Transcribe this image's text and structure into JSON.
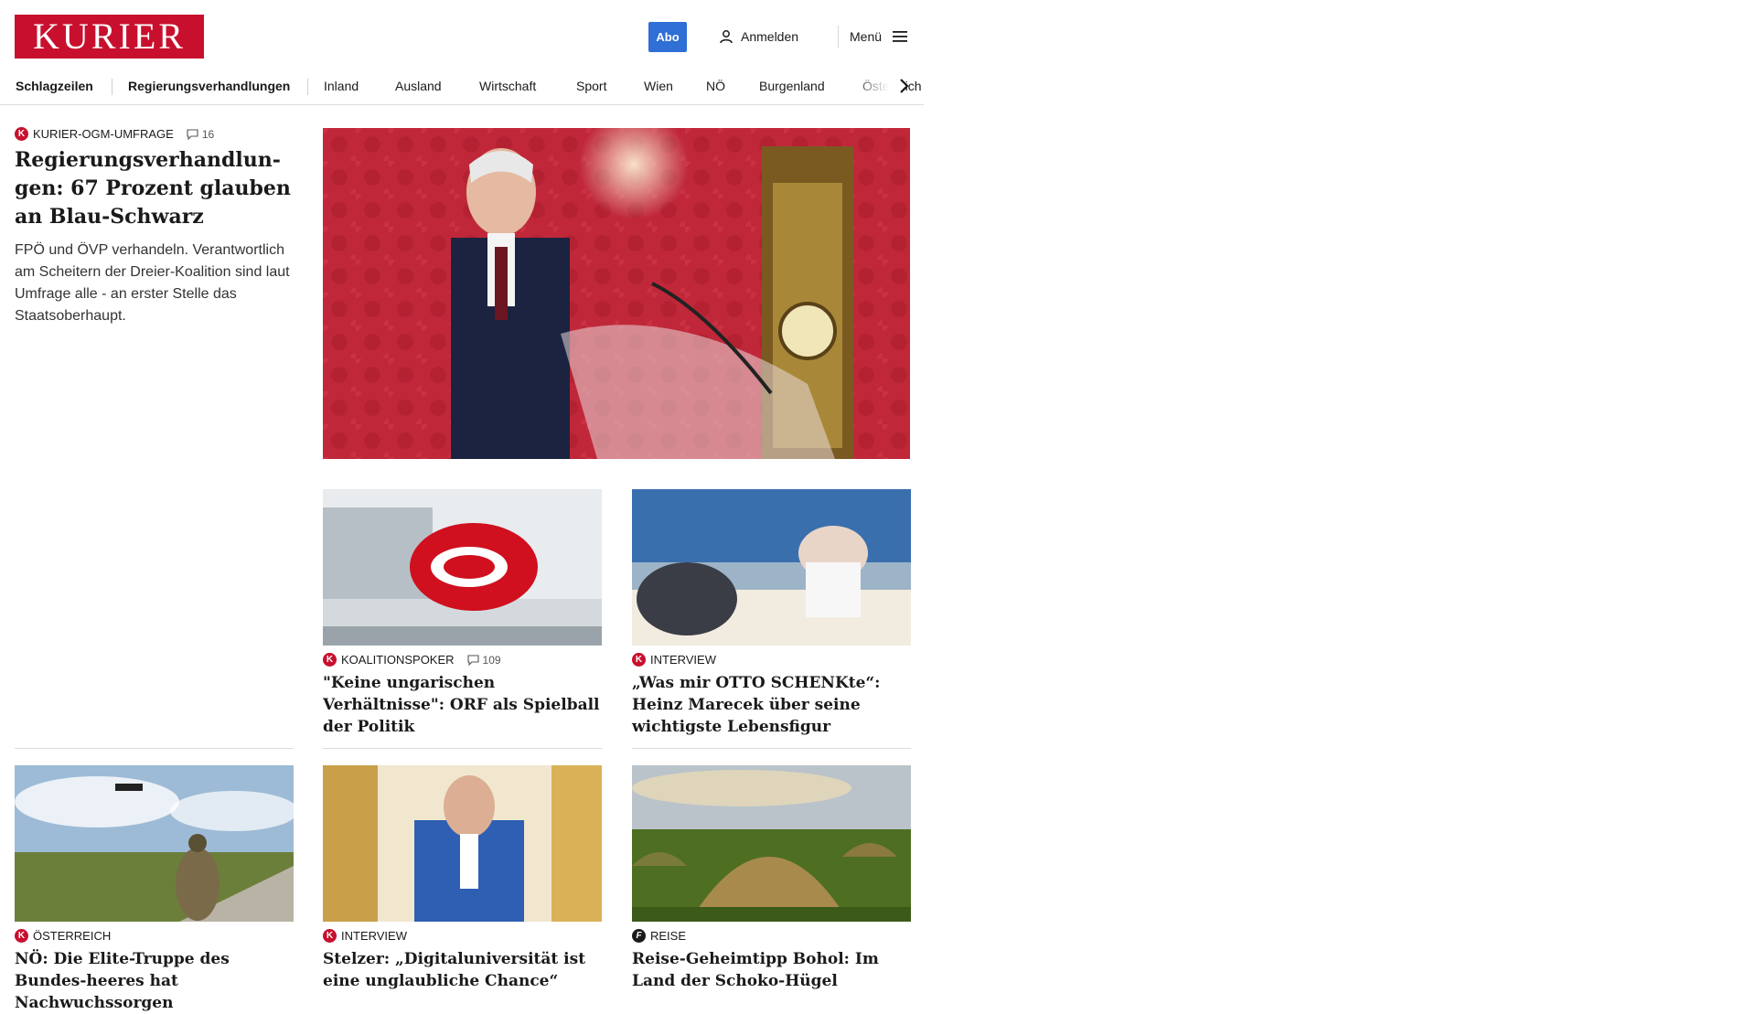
{
  "header": {
    "logo": "KURIER",
    "abo_label": "Abo",
    "login_label": "Anmelden",
    "menu_label": "Menü",
    "brand_color": "#c8102e",
    "abo_color": "#2f6fd6"
  },
  "nav": {
    "items": [
      "Schlagzeilen",
      "Regierungsverhandlungen",
      "Inland",
      "Ausland",
      "Wirtschaft",
      "Sport",
      "Wien",
      "NÖ",
      "Burgenland",
      "Österreich"
    ]
  },
  "lead": {
    "kicker": "KURIER-OGM-UMFRAGE",
    "comments": "16",
    "title": "Regierungsverhandlun-gen: 67 Prozent glauben an Blau-Schwarz",
    "teaser": "FPÖ und ÖVP verhandeln. Verantwortlich am Scheitern der Dreier-Koalition sind laut Umfrage alle - an erster Stelle das Staatsoberhaupt."
  },
  "cards": [
    {
      "badge": "K",
      "kicker": "KOALITIONSPOKER",
      "comments": "109",
      "title": "\"Keine ungarischen Verhältnisse\": ORF als Spielball der Politik"
    },
    {
      "badge": "K",
      "kicker": "INTERVIEW",
      "title": "„Was mir OTTO SCHENKte“: Heinz Marecek über seine wichtigste Lebensfigur"
    },
    {
      "badge": "K",
      "kicker": "ÖSTERREICH",
      "title": "NÖ: Die Elite-Truppe des Bundes-heeres hat Nachwuchssorgen"
    },
    {
      "badge": "K",
      "kicker": "INTERVIEW",
      "title": "Stelzer: „Digitaluniversität ist eine unglaubliche Chance“"
    },
    {
      "badge": "f",
      "kicker": "REISE",
      "title": "Reise-Geheimtipp Bohol: Im Land der Schoko-Hügel"
    }
  ]
}
